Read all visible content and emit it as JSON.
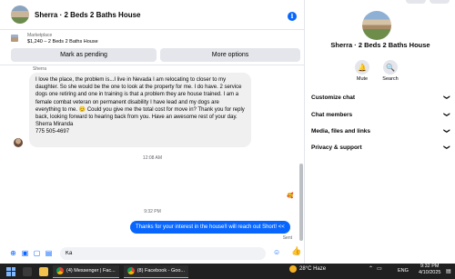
{
  "chat": {
    "title": "Sherra · 2 Beds 2 Baths House",
    "marketplace_label": "Marketplace",
    "listing_desc": "$1,240 – 2 Beds 2 Baths House",
    "mark_pending_label": "Mark as pending",
    "more_options_label": "More options"
  },
  "thread": {
    "sender_name": "Sherra",
    "incoming_message": "I love the place, the problem is...I live in Nevada I am relocating to closer to my daughter. So she would be the one to look at the property for me. I do have. 2 service dogs one retiring and one in training is that a problem they are house trained. I am a female combat veteran on permanent disability  I have lead and my dogs are everything to me. 😊 Could you give me the total cost for move in? Thank you for reply back, looking forward to hearing back from you. Have an awesome rest of your day.",
    "signature_name": "Sherra Miranda",
    "signature_phone": "775 505-4697",
    "time1": "12:08 AM",
    "reaction": "🥰",
    "time2": "9:32 PM",
    "outgoing_message": "Thanks for your interest in the house!I will reach out Short! <<",
    "sent_status": "Sent"
  },
  "composer": {
    "input_value": "Ka",
    "icons": [
      "plus-icon",
      "image-icon",
      "sticker-icon",
      "gif-icon"
    ]
  },
  "panel": {
    "name": "Sherra · 2 Beds 2 Baths House",
    "actions": [
      {
        "label": "Mute",
        "icon": "🔔"
      },
      {
        "label": "Search",
        "icon": "🔍"
      }
    ],
    "sections": [
      {
        "label": "Customize chat"
      },
      {
        "label": "Chat members"
      },
      {
        "label": "Media, files and links"
      },
      {
        "label": "Privacy & support"
      }
    ]
  },
  "taskbar": {
    "tasks": [
      {
        "label": "(4) Messenger | Fac..."
      },
      {
        "label": "(8) Facebook - Goo..."
      }
    ],
    "weather": "28°C  Haze",
    "language": "ENG",
    "time": "9:32 PM",
    "date": "4/10/2025"
  }
}
